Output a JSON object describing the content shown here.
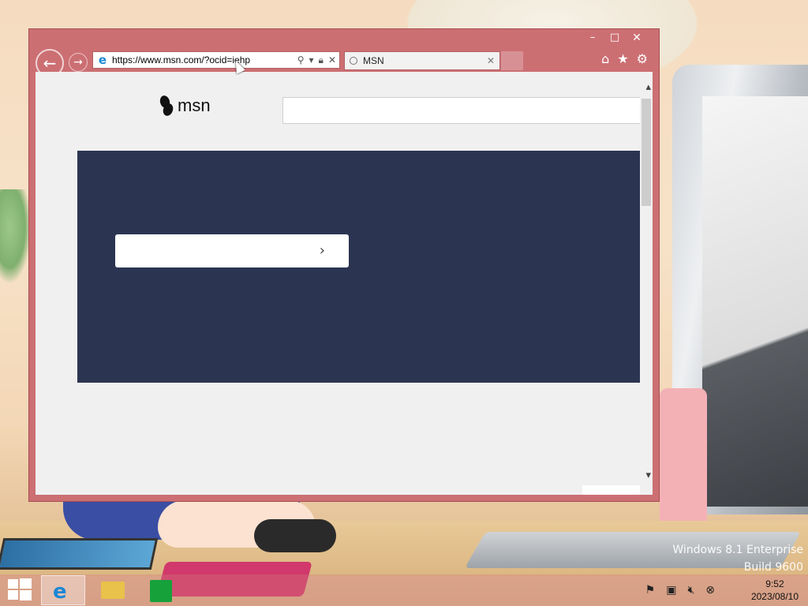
{
  "browser": {
    "url": "https://www.msn.com/?ocid=iehp",
    "tab_title": "MSN",
    "window_controls": {
      "minimize": "–",
      "maximize": "□",
      "close": "✕"
    }
  },
  "page": {
    "logo_text": "msn",
    "search_placeholder": "",
    "hero_input_placeholder": ""
  },
  "desktop": {
    "watermark_line1": "Windows 8.1 Enterprise",
    "watermark_line2": "Build 9600"
  },
  "taskbar": {
    "apps": [
      "Start",
      "Internet Explorer",
      "File Explorer",
      "Store"
    ],
    "clock_time": "9:52",
    "clock_date": "2023/08/10"
  },
  "colors": {
    "window_frame": "#cc6f73",
    "hero_background": "#2b3552",
    "ie_blue": "#1b87d6"
  }
}
